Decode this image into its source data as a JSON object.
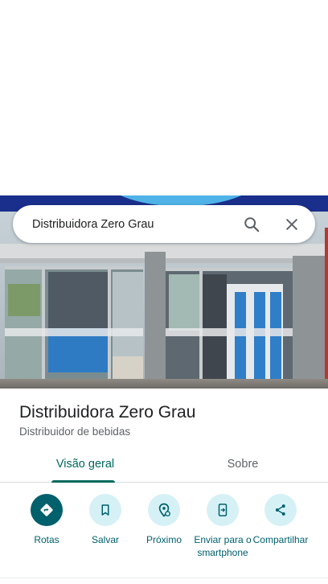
{
  "search": {
    "query": "Distribuidora Zero Grau",
    "search_icon": "search-icon",
    "close_icon": "close-icon"
  },
  "place": {
    "name": "Distribuidora Zero Grau",
    "category": "Distribuidor de bebidas"
  },
  "tabs": [
    {
      "label": "Visão geral",
      "selected": true
    },
    {
      "label": "Sobre",
      "selected": false
    }
  ],
  "actions": [
    {
      "label": "Rotas",
      "icon": "directions-icon"
    },
    {
      "label": "Salvar",
      "icon": "bookmark-icon"
    },
    {
      "label": "Próximo",
      "icon": "nearby-icon"
    },
    {
      "label": "Enviar para o smartphone",
      "icon": "send-to-phone-icon"
    },
    {
      "label": "Compartilhar",
      "icon": "share-icon"
    }
  ],
  "colors": {
    "accent": "#00606c",
    "accent_light": "#d6f1f6",
    "tab_active": "#00695c",
    "text_primary": "#202124",
    "text_secondary": "#5f6368"
  }
}
